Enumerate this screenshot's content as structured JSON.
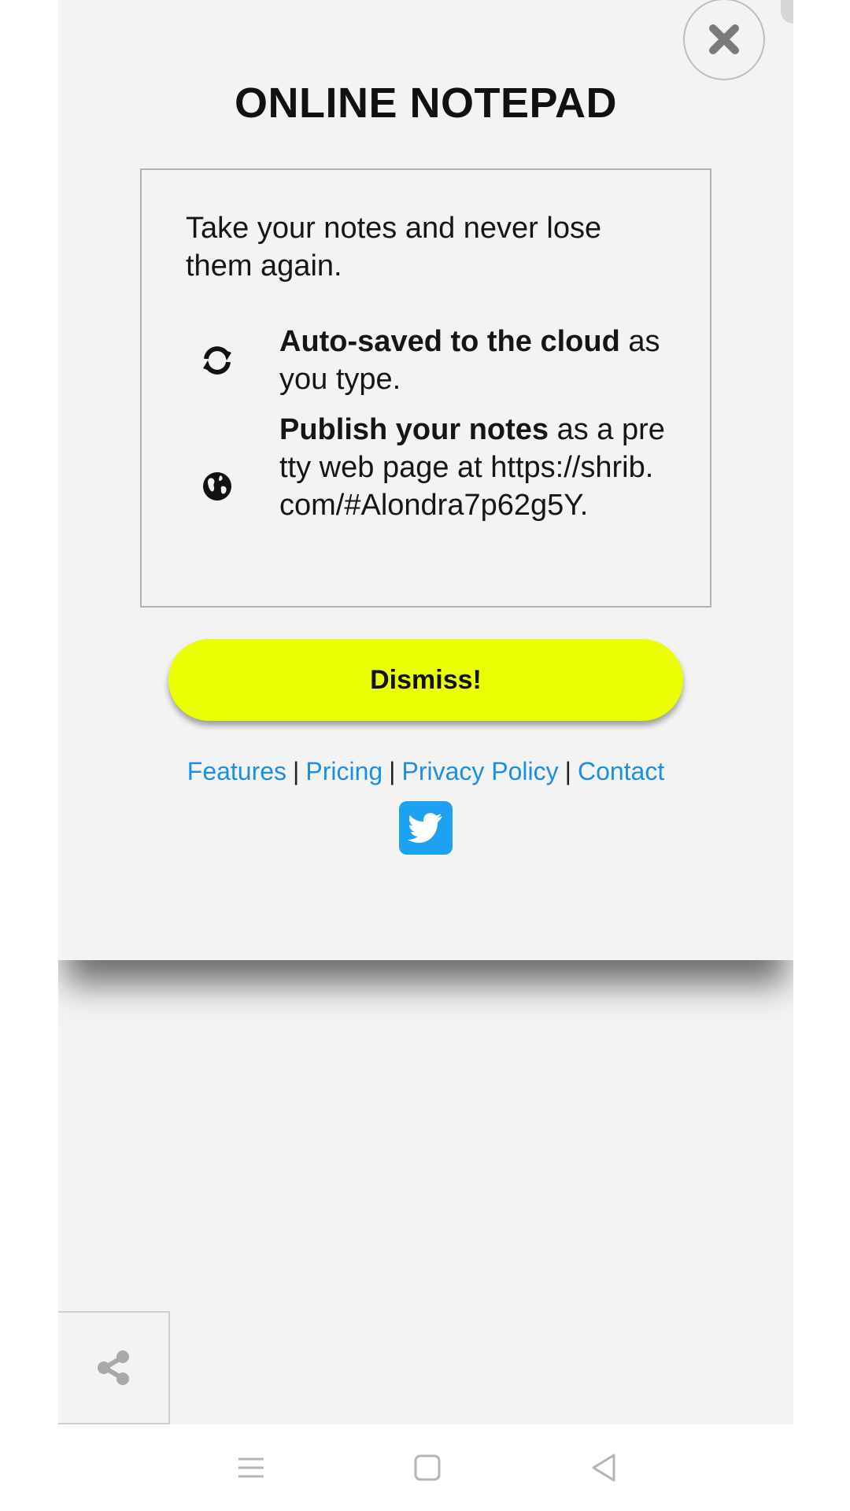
{
  "modal": {
    "title": "ONLINE NOTEPAD",
    "intro": "Take your notes and never lose them again.",
    "features": [
      {
        "icon": "sync-icon",
        "bold": "Auto-saved to the cloud",
        "rest": " as you type."
      },
      {
        "icon": "globe-icon",
        "bold": "Publish your notes",
        "rest": " as a pretty web page at https://shrib.com/#Alondra7p62g5Y."
      }
    ],
    "dismiss_label": "Dismiss!",
    "close_icon": "close-icon"
  },
  "footer": {
    "links": [
      "Features",
      "Pricing",
      "Privacy Policy",
      "Contact"
    ],
    "separator": "|",
    "social_icon": "twitter-icon"
  },
  "share": {
    "icon": "share-icon"
  },
  "system_nav": {
    "icons": [
      "menu-icon",
      "home-icon",
      "back-icon"
    ]
  },
  "colors": {
    "accent_button": "#eaff00",
    "link": "#1a8fe3",
    "twitter": "#1da1f2",
    "background": "#f3f3f3"
  }
}
